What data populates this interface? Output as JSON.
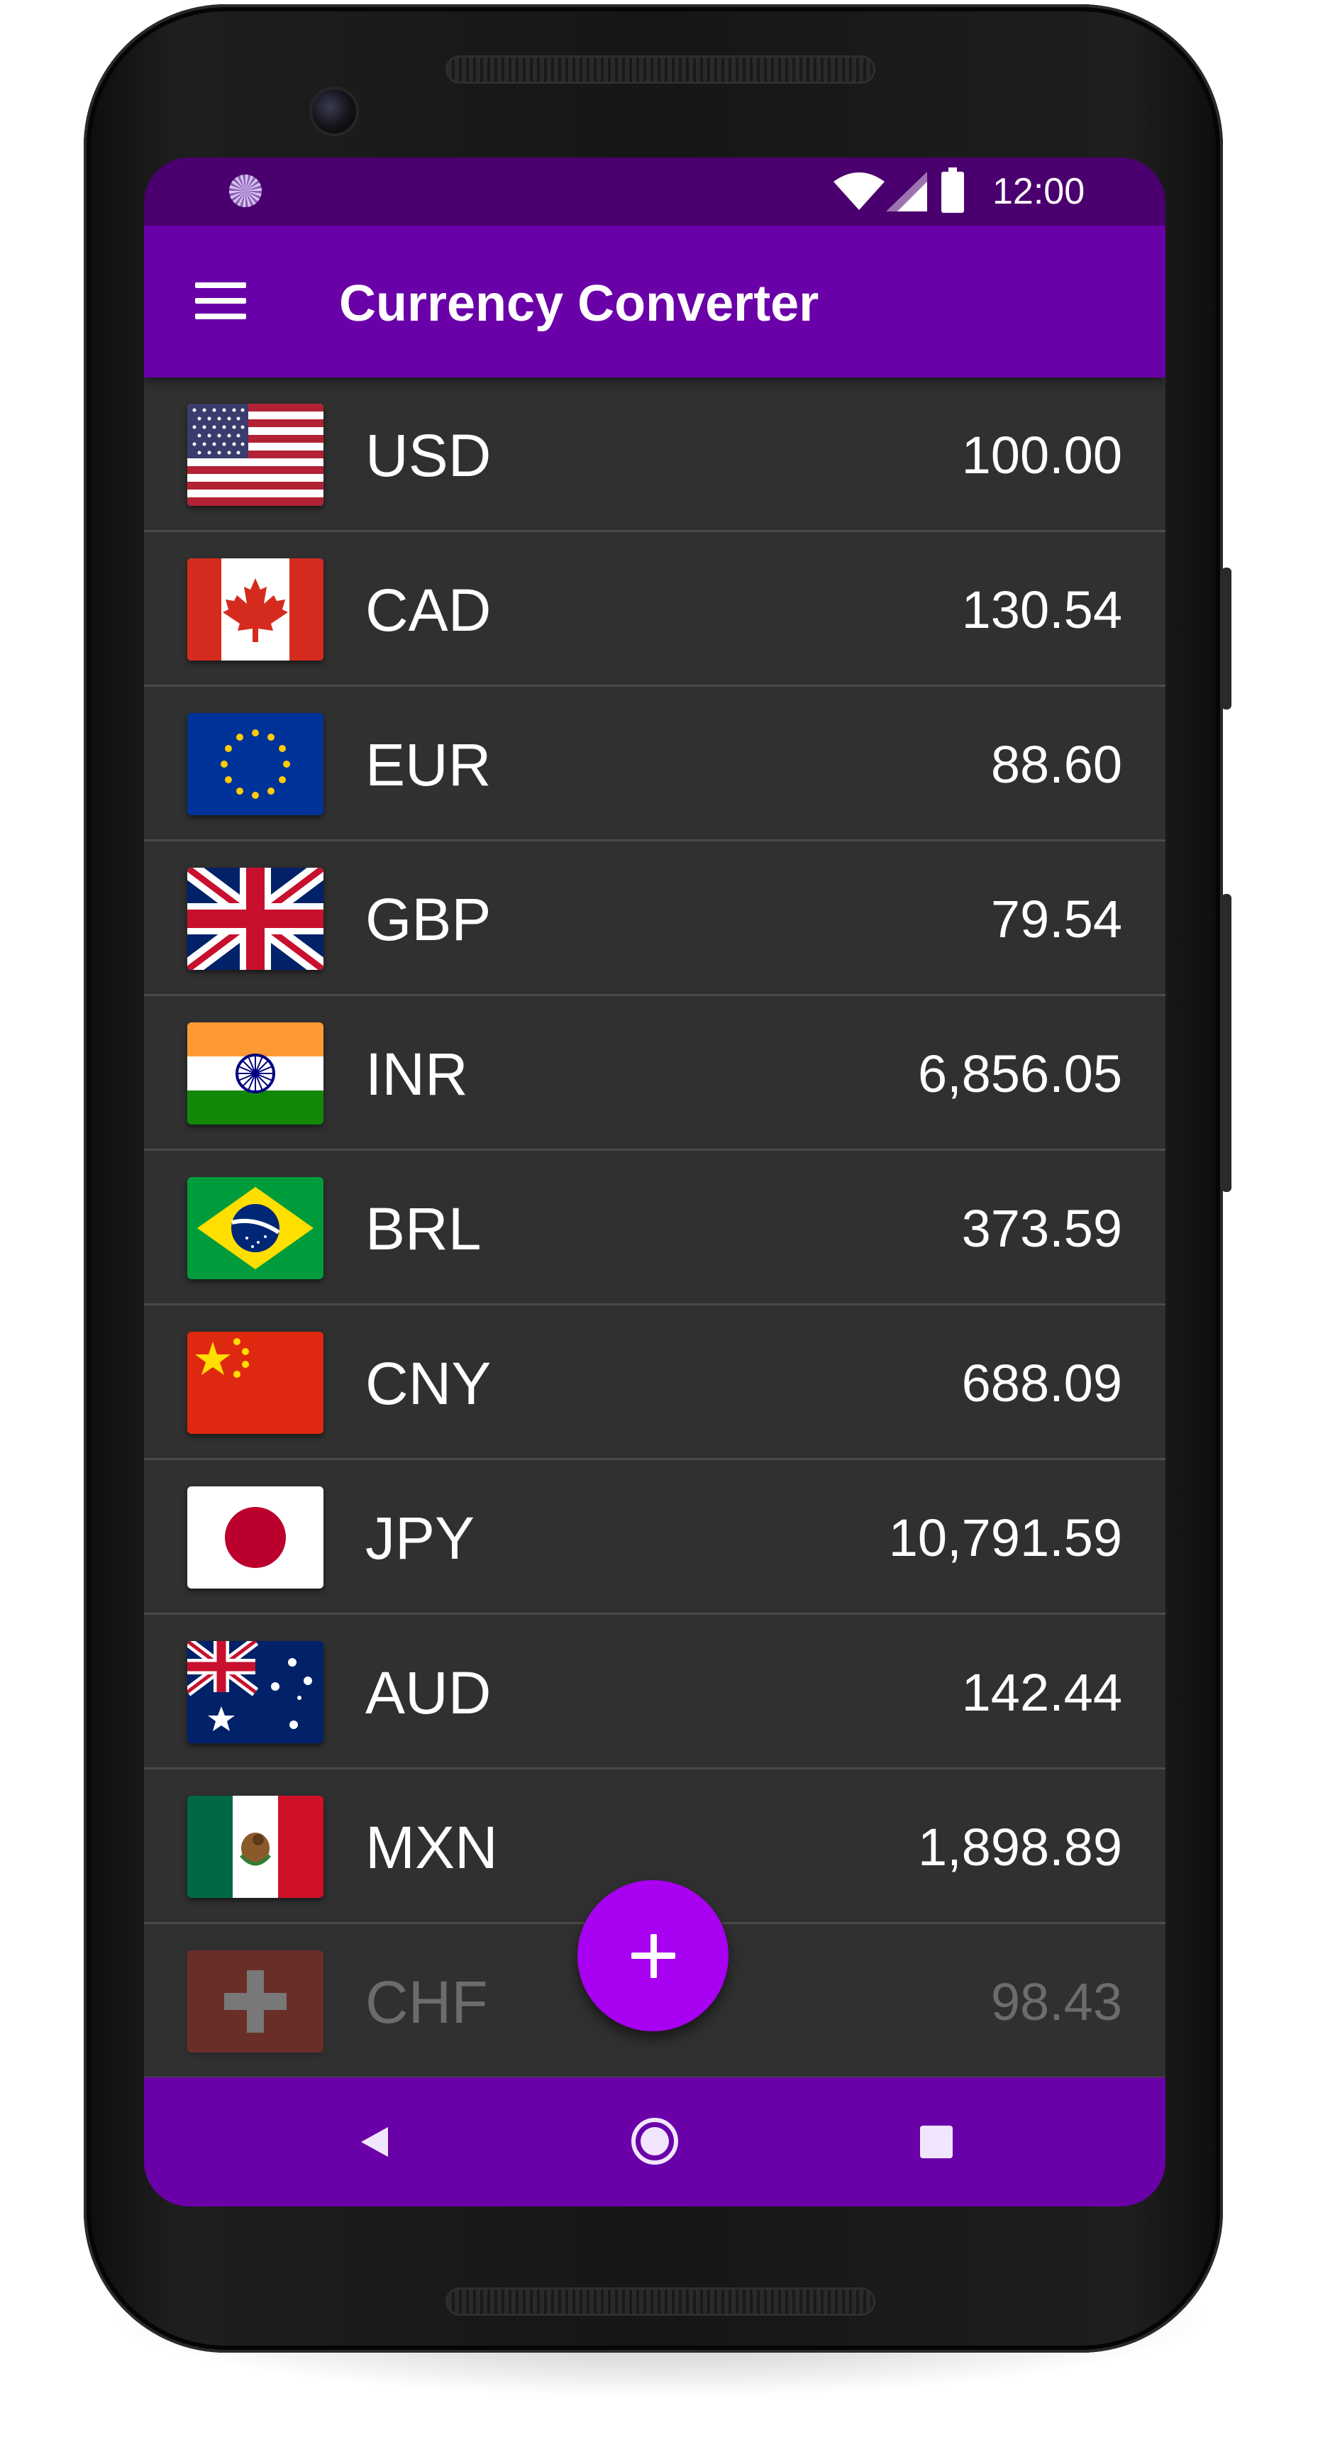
{
  "status_bar": {
    "time": "12:00"
  },
  "app_bar": {
    "title": "Currency Converter"
  },
  "currencies": [
    {
      "code": "USD",
      "amount": "100.00"
    },
    {
      "code": "CAD",
      "amount": "130.54"
    },
    {
      "code": "EUR",
      "amount": "88.60"
    },
    {
      "code": "GBP",
      "amount": "79.54"
    },
    {
      "code": "INR",
      "amount": "6,856.05"
    },
    {
      "code": "BRL",
      "amount": "373.59"
    },
    {
      "code": "CNY",
      "amount": "688.09"
    },
    {
      "code": "JPY",
      "amount": "10,791.59"
    },
    {
      "code": "AUD",
      "amount": "142.44"
    },
    {
      "code": "MXN",
      "amount": "1,898.89"
    },
    {
      "code": "CHF",
      "amount": "98.43"
    }
  ],
  "fab": {
    "icon": "plus-icon"
  },
  "colors": {
    "status_bar": "#4a006e",
    "app_bar": "#6a00a8",
    "fab": "#a800f0",
    "list_background": "#303030"
  }
}
